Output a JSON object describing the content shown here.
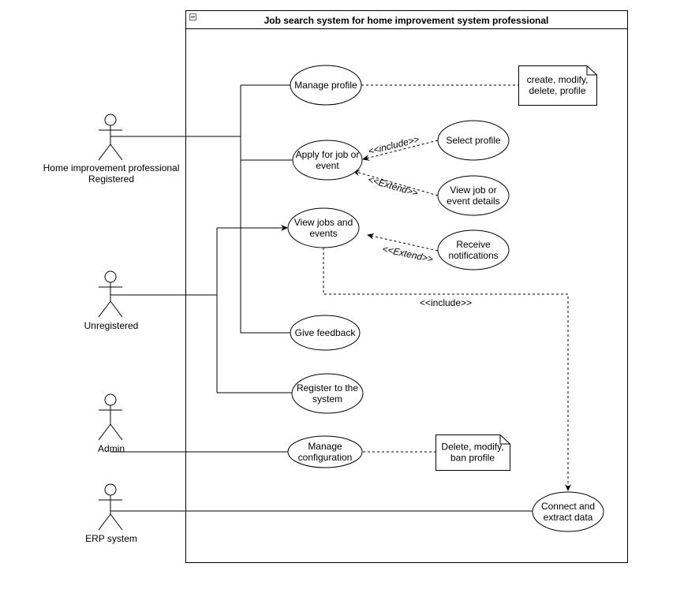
{
  "system": {
    "title": "Job search system for home improvement system professional",
    "collapse_icon": "minus-box-icon"
  },
  "actors": [
    {
      "id": "professional",
      "label_lines": [
        "Home improvement professional",
        "Registered"
      ]
    },
    {
      "id": "unregistered",
      "label_lines": [
        "Unregistered"
      ]
    },
    {
      "id": "admin",
      "label_lines": [
        "Admin"
      ]
    },
    {
      "id": "erp",
      "label_lines": [
        "ERP system"
      ]
    }
  ],
  "use_cases": [
    {
      "id": "manage-profile",
      "label_lines": [
        "Manage profile"
      ]
    },
    {
      "id": "apply",
      "label_lines": [
        "Apply for job or",
        "event"
      ]
    },
    {
      "id": "view-jobs",
      "label_lines": [
        "View jobs and",
        "events"
      ]
    },
    {
      "id": "give-feedback",
      "label_lines": [
        "Give feedback"
      ]
    },
    {
      "id": "register",
      "label_lines": [
        "Register to the",
        "system"
      ]
    },
    {
      "id": "manage-config",
      "label_lines": [
        "Manage",
        "configuration"
      ]
    },
    {
      "id": "select-profile",
      "label_lines": [
        "Select profile"
      ]
    },
    {
      "id": "view-details",
      "label_lines": [
        "View job or",
        "event details"
      ]
    },
    {
      "id": "receive-notifications",
      "label_lines": [
        "Receive",
        "notifications"
      ]
    },
    {
      "id": "connect-extract",
      "label_lines": [
        "Connect and",
        "extract data"
      ]
    }
  ],
  "notes": [
    {
      "id": "profile-note",
      "label_lines": [
        "create, modify,",
        "delete, profile"
      ]
    },
    {
      "id": "config-note",
      "label_lines": [
        "Delete, modify,",
        "ban profile"
      ]
    }
  ],
  "relations": {
    "include_1": "<<include>>",
    "extend_1": "<<Extend>>",
    "extend_2": "<<Extend>>",
    "include_2": "<<include>>"
  }
}
